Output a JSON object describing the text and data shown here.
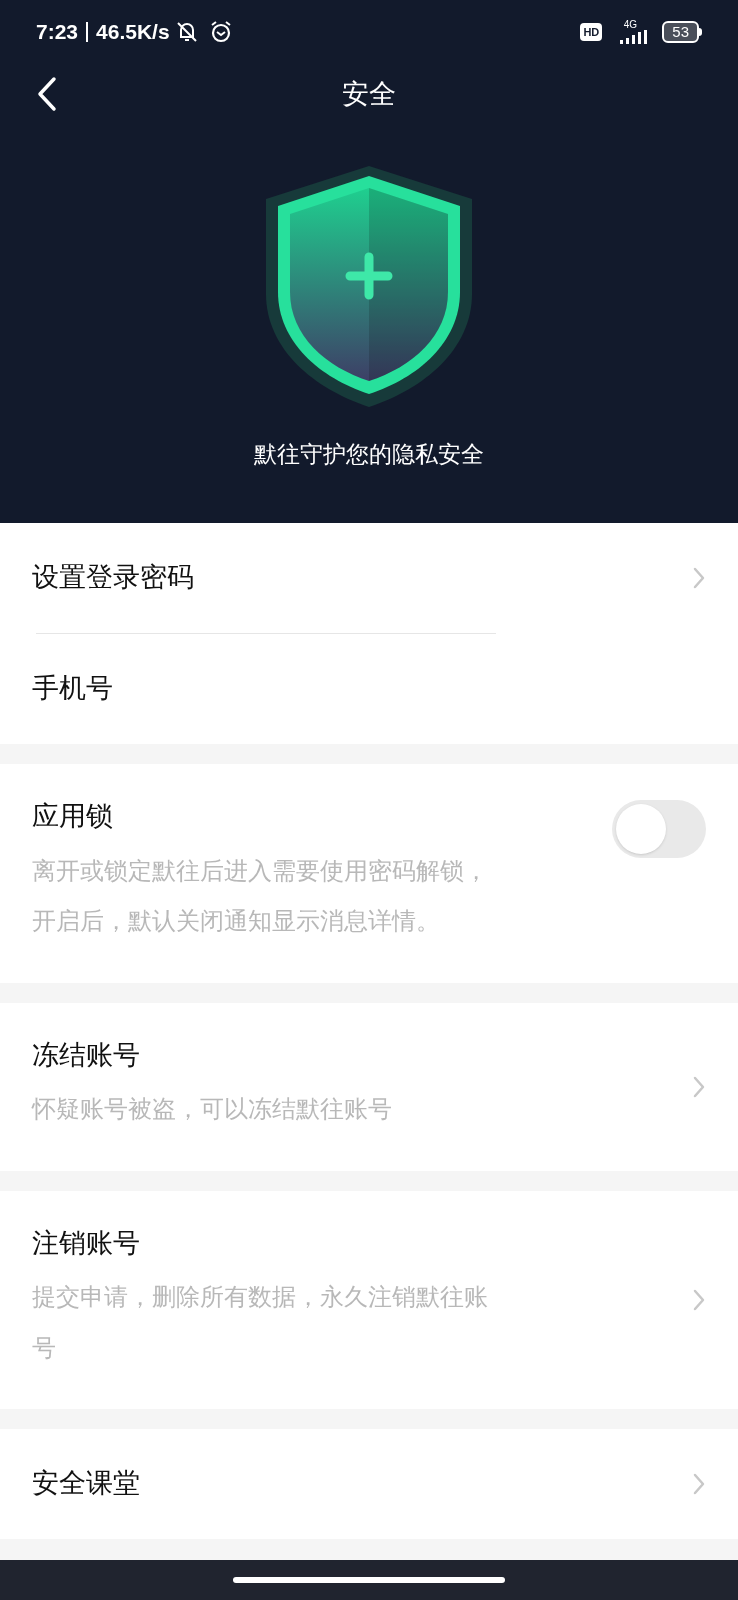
{
  "status_bar": {
    "time": "7:23",
    "speed": "46.5K/s",
    "hd": "HD",
    "network": "4G",
    "battery": "53"
  },
  "header": {
    "title": "安全",
    "tagline": "默往守护您的隐私安全"
  },
  "sections": [
    {
      "items": [
        {
          "kind": "link",
          "label": "设置登录密码",
          "chevron": true
        },
        {
          "kind": "link",
          "label": "手机号",
          "chevron": false
        }
      ]
    },
    {
      "items": [
        {
          "kind": "toggle",
          "label": "应用锁",
          "description": "离开或锁定默往后进入需要使用密码解锁，开启后，默认关闭通知显示消息详情。",
          "on": false
        }
      ]
    },
    {
      "items": [
        {
          "kind": "link",
          "label": "冻结账号",
          "description": "怀疑账号被盗，可以冻结默往账号",
          "chevron": true
        }
      ]
    },
    {
      "items": [
        {
          "kind": "link",
          "label": "注销账号",
          "description": "提交申请，删除所有数据，永久注销默往账号",
          "chevron": true
        }
      ]
    },
    {
      "items": [
        {
          "kind": "link",
          "label": "安全课堂",
          "chevron": true
        }
      ]
    }
  ]
}
